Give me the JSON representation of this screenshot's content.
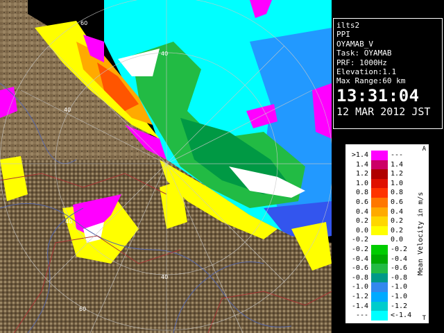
{
  "info": {
    "site": "ilts2",
    "product": "PPI",
    "product_name": "OYAMAB_V",
    "task": "Task: OYAMAB",
    "prf": "PRF: 1000Hz",
    "elevation": "Elevation:1.1",
    "max_range": "Max Range:60 km",
    "time": "13:31:04",
    "date": "12 MAR 2012 JST"
  },
  "legend": {
    "title": "Mean Velocity in m/s",
    "top_mark": "A",
    "bottom_mark": "T",
    "rows": [
      {
        "l": ">1.4",
        "r": "---",
        "color": "#ff00ff"
      },
      {
        "l": "1.4",
        "r": "1.4",
        "color": "#cc0066"
      },
      {
        "l": "1.2",
        "r": "1.2",
        "color": "#b00000"
      },
      {
        "l": "1.0",
        "r": "1.0",
        "color": "#e01000"
      },
      {
        "l": "0.8",
        "r": "0.8",
        "color": "#ff3300"
      },
      {
        "l": "0.6",
        "r": "0.6",
        "color": "#ff7700"
      },
      {
        "l": "0.4",
        "r": "0.4",
        "color": "#ffaa00"
      },
      {
        "l": "0.2",
        "r": "0.2",
        "color": "#ffd700"
      },
      {
        "l": "0.0",
        "r": "0.2",
        "color": "#ffff00"
      },
      {
        "l": "-0.2",
        "r": "0.0",
        "color": "#ffffff"
      },
      {
        "l": "-0.2",
        "r": "-0.2",
        "color": "#00cc00"
      },
      {
        "l": "-0.4",
        "r": "-0.4",
        "color": "#00aa00"
      },
      {
        "l": "-0.6",
        "r": "-0.6",
        "color": "#22bb44"
      },
      {
        "l": "-0.8",
        "r": "-0.8",
        "color": "#009988"
      },
      {
        "l": "-1.0",
        "r": "-1.0",
        "color": "#3388ee"
      },
      {
        "l": "-1.2",
        "r": "-1.0",
        "color": "#00aaff"
      },
      {
        "l": "-1.4",
        "r": "-1.2",
        "color": "#00cccc"
      },
      {
        "l": "---",
        "r": "<-1.4",
        "color": "#00ffff"
      }
    ]
  },
  "range_labels": {
    "r40": "40",
    "r60": "60"
  },
  "colors": {
    "terrain": "#8a7454",
    "terrain_dark": "#5e4c34",
    "grid": "#c8c8c8",
    "river": "#5566aa",
    "boundary": "#aa3333"
  }
}
